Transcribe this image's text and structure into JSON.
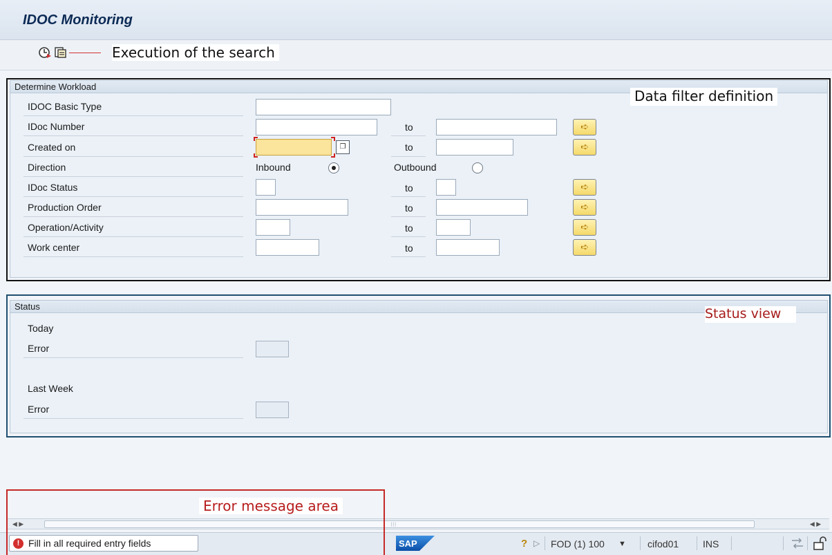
{
  "header": {
    "title": "IDOC Monitoring"
  },
  "annotations": {
    "execution": "Execution of the search",
    "data_filter": "Data filter definition",
    "status_view": "Status view",
    "error_area": "Error message area"
  },
  "toolbar": {
    "icons": [
      "execute-icon",
      "selection-variant-icon"
    ]
  },
  "workload": {
    "title": "Determine Workload",
    "rows": [
      {
        "label": "IDOC Basic Type",
        "value": ""
      },
      {
        "label": "IDoc Number",
        "from": "",
        "to_label": "to",
        "to": ""
      },
      {
        "label": "Created on",
        "from": "",
        "to_label": "to",
        "to": "",
        "required": true
      },
      {
        "label": "Direction",
        "options": [
          "Inbound",
          "Outbound"
        ],
        "selected": "Inbound"
      },
      {
        "label": "IDoc Status",
        "from": "",
        "to_label": "to",
        "to": ""
      },
      {
        "label": "Production Order",
        "from": "",
        "to_label": "to",
        "to": ""
      },
      {
        "label": "Operation/Activity",
        "from": "",
        "to_label": "to",
        "to": ""
      },
      {
        "label": "Work center",
        "from": "",
        "to_label": "to",
        "to": ""
      }
    ]
  },
  "status": {
    "title": "Status",
    "today_label": "Today",
    "error_label": "Error",
    "last_week_label": "Last Week",
    "error_label_2": "Error"
  },
  "statusbar": {
    "message": "Fill in all required entry fields",
    "logo": "SAP",
    "system": "FOD (1) 100",
    "client": "cifod01",
    "mode": "INS"
  },
  "colors": {
    "accent_title": "#0b2a55",
    "required_field": "#fbe49b",
    "error_red": "#d32f2f",
    "annotation_red": "#a61b1b"
  }
}
